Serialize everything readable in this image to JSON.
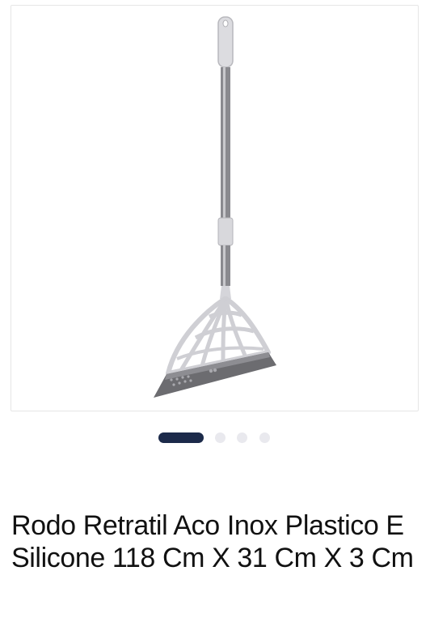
{
  "product": {
    "title": "Rodo Retratil Aco Inox Plastico E Silicone 118 Cm X 31 Cm X 3 Cm",
    "image_alt": "Rodo retrátil com cabo de aço inox e lâmina de silicone"
  },
  "carousel": {
    "slide_count": 4,
    "active_index": 0
  },
  "colors": {
    "active_dot": "#1c2a4a",
    "inactive_dot": "#e9e9ee",
    "handle_grip": "#d9d9de",
    "pole": "#8c8c90",
    "head_frame": "#cfcfd4",
    "blade": "#6a6a6e"
  }
}
